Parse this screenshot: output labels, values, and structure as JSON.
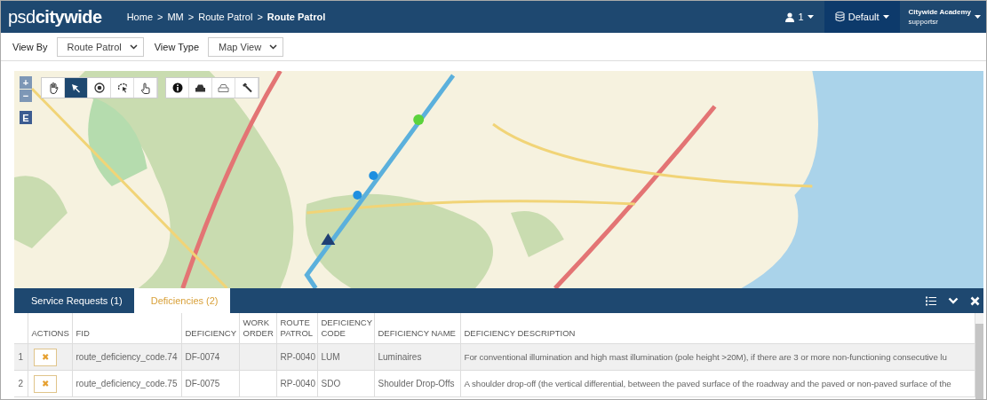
{
  "header": {
    "logo_light": "psd",
    "logo_bold": "citywide",
    "breadcrumb": [
      "Home",
      ">",
      "MM",
      ">",
      "Route Patrol",
      ">",
      "Route Patrol"
    ],
    "user_count": "1",
    "database": "Default",
    "account": {
      "name": "Citywide Academy",
      "user": "supportsr"
    }
  },
  "filters": [
    {
      "label": "View By",
      "value": "Route Patrol"
    },
    {
      "label": "View Type",
      "value": "Map View"
    }
  ],
  "map": {
    "zoom_in": "+",
    "zoom_out": "−",
    "edit": "E",
    "tool_groups": [
      [
        {
          "kind": "pan",
          "selected": false
        },
        {
          "kind": "pointer",
          "selected": true
        },
        {
          "kind": "target",
          "selected": false
        },
        {
          "kind": "lasso",
          "selected": false
        },
        {
          "kind": "touch",
          "selected": false
        }
      ],
      [
        {
          "kind": "info",
          "selected": false
        },
        {
          "kind": "car",
          "selected": false
        },
        {
          "kind": "car-outline",
          "selected": false
        },
        {
          "kind": "hammer",
          "selected": false
        }
      ]
    ]
  },
  "panel": {
    "tabs": [
      {
        "label": "Service Requests (1)",
        "selected": false
      },
      {
        "label": "Deficiencies (2)",
        "selected": true
      }
    ],
    "table": {
      "columns": [
        "",
        "ACTIONS",
        "FID",
        "DEFICIENCY",
        "WORK ORDER",
        "ROUTE PATROL",
        "DEFICIENCY CODE",
        "DEFICIENCY NAME",
        "DEFICIENCY DESCRIPTION"
      ],
      "rows": [
        {
          "selected": true,
          "cells": [
            "1",
            "✖",
            "route_deficiency_code.74",
            "DF-0074",
            "",
            "RP-0040",
            "LUM",
            "Luminaires",
            "For conventional illumination and high mast illumination (pole height >20M), if there are 3 or more non-functioning consecutive lu"
          ]
        },
        {
          "selected": false,
          "cells": [
            "2",
            "✖",
            "route_deficiency_code.75",
            "DF-0075",
            "",
            "RP-0040",
            "SDO",
            "Shoulder Drop-Offs",
            "A shoulder drop-off (the vertical differential, between the paved surface of the roadway and the paved or non-paved surface of the"
          ]
        }
      ]
    }
  }
}
